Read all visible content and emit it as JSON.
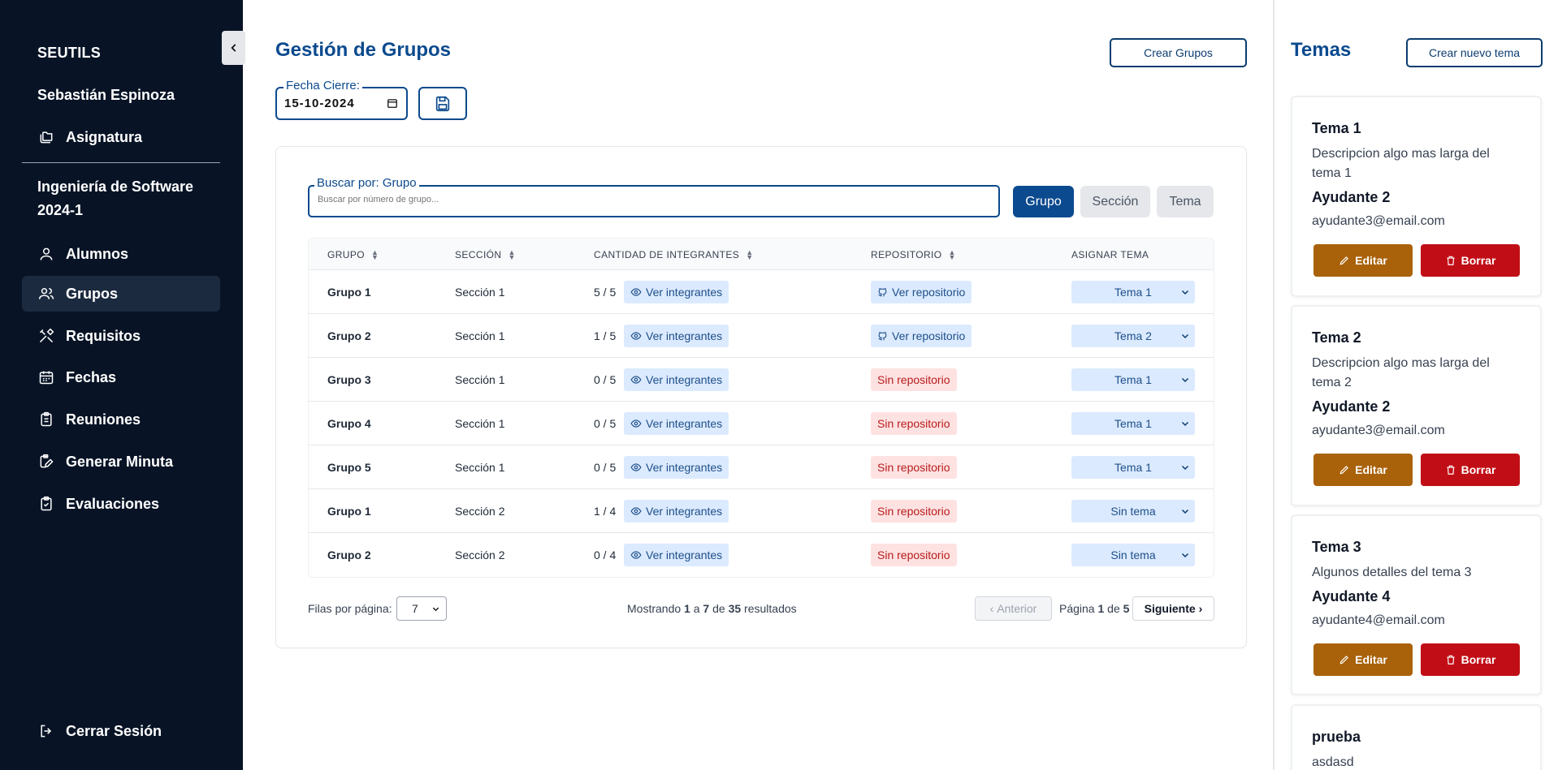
{
  "sidebar": {
    "brand": "SEUTILS",
    "user": "Sebastián Espinoza",
    "subject": "Asignatura",
    "course": "Ingeniería de Software 2024-1",
    "items": [
      {
        "label": "Alumnos",
        "icon": "user-icon"
      },
      {
        "label": "Grupos",
        "icon": "users-icon"
      },
      {
        "label": "Requisitos",
        "icon": "tools-icon"
      },
      {
        "label": "Fechas",
        "icon": "calendar-icon"
      },
      {
        "label": "Reuniones",
        "icon": "clipboard-icon"
      },
      {
        "label": "Generar Minuta",
        "icon": "edit-doc-icon"
      },
      {
        "label": "Evaluaciones",
        "icon": "check-doc-icon"
      }
    ],
    "logout": "Cerrar Sesión",
    "active_color": "#1c2a3f"
  },
  "main": {
    "title": "Gestión de Grupos",
    "create_button": "Crear Grupos",
    "date_label": "Fecha Cierre:",
    "date_value": "15-10-2024",
    "search_label": "Buscar por: Grupo",
    "search_placeholder": "Buscar por número de grupo...",
    "filters": [
      "Grupo",
      "Sección",
      "Tema"
    ],
    "columns": [
      "GRUPO",
      "SECCIÓN",
      "CANTIDAD DE INTEGRANTES",
      "REPOSITORIO",
      "ASIGNAR TEMA"
    ],
    "view_members_label": "Ver integrantes",
    "rows": [
      {
        "grupo": "Grupo 1",
        "seccion": "Sección 1",
        "cantidad": "5 / 5",
        "repo": "Ver repositorio",
        "has_repo": true,
        "tema": "Tema 1"
      },
      {
        "grupo": "Grupo 2",
        "seccion": "Sección 1",
        "cantidad": "1 / 5",
        "repo": "Ver repositorio",
        "has_repo": true,
        "tema": "Tema 2"
      },
      {
        "grupo": "Grupo 3",
        "seccion": "Sección 1",
        "cantidad": "0 / 5",
        "repo": "Sin repositorio",
        "has_repo": false,
        "tema": "Tema 1"
      },
      {
        "grupo": "Grupo 4",
        "seccion": "Sección 1",
        "cantidad": "0 / 5",
        "repo": "Sin repositorio",
        "has_repo": false,
        "tema": "Tema 1"
      },
      {
        "grupo": "Grupo 5",
        "seccion": "Sección 1",
        "cantidad": "0 / 5",
        "repo": "Sin repositorio",
        "has_repo": false,
        "tema": "Tema 1"
      },
      {
        "grupo": "Grupo 1",
        "seccion": "Sección 2",
        "cantidad": "1 / 4",
        "repo": "Sin repositorio",
        "has_repo": false,
        "tema": "Sin tema"
      },
      {
        "grupo": "Grupo 2",
        "seccion": "Sección 2",
        "cantidad": "0 / 4",
        "repo": "Sin repositorio",
        "has_repo": false,
        "tema": "Sin tema"
      }
    ],
    "pagination": {
      "rows_per_page_label": "Filas por página:",
      "rows_per_page": "7",
      "showing_prefix": "Mostrando",
      "from": "1",
      "to_word": "a",
      "to": "7",
      "of_word": "de",
      "total": "35",
      "results_word": "resultados",
      "prev": "Anterior",
      "page_word": "Página",
      "page": "1",
      "pages_of": "de",
      "pages": "5",
      "next": "Siguiente"
    },
    "accent_color": "#0b4a8e"
  },
  "right_panel": {
    "title": "Temas",
    "create_button": "Crear nuevo tema",
    "edit_label": "Editar",
    "delete_label": "Borrar",
    "temas": [
      {
        "title": "Tema 1",
        "description": "Descripcion algo mas larga del tema 1",
        "ayudante": "Ayudante 2",
        "email": "ayudante3@email.com"
      },
      {
        "title": "Tema 2",
        "description": "Descripcion algo mas larga del tema 2",
        "ayudante": "Ayudante 2",
        "email": "ayudante3@email.com"
      },
      {
        "title": "Tema 3",
        "description": "Algunos detalles del tema 3",
        "ayudante": "Ayudante 4",
        "email": "ayudante4@email.com"
      },
      {
        "title": "prueba",
        "description": "asdasd"
      }
    ],
    "edit_color": "#a9620a",
    "delete_color": "#c10e16"
  }
}
